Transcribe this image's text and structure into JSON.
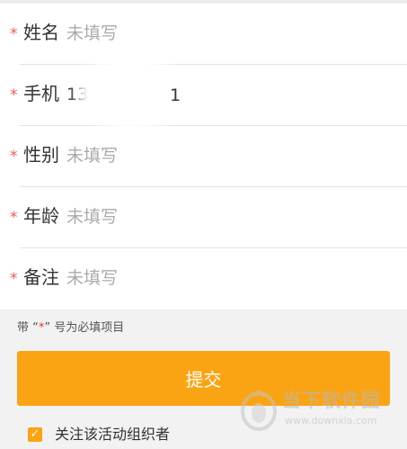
{
  "form": {
    "required_mark": "*",
    "fields": [
      {
        "label": "姓名",
        "value": "未填写",
        "filled": false
      },
      {
        "label": "手机",
        "value": "13",
        "filled": true,
        "value_tail": "1"
      },
      {
        "label": "性别",
        "value": "未填写",
        "filled": false
      },
      {
        "label": "年龄",
        "value": "未填写",
        "filled": false
      },
      {
        "label": "备注",
        "value": "未填写",
        "filled": false
      }
    ]
  },
  "hint": {
    "prefix": "带 “",
    "star": "*",
    "suffix": "” 号为必填项目"
  },
  "submit_label": "提交",
  "follow": {
    "checked": true,
    "check_glyph": "✓",
    "label": "关注该活动组织者"
  },
  "watermark": {
    "title": "当下软件园",
    "url": "www.downxia.com"
  },
  "colors": {
    "accent": "#fba413",
    "required": "#f05a50",
    "placeholder": "#aaaaaa",
    "text": "#333333"
  }
}
